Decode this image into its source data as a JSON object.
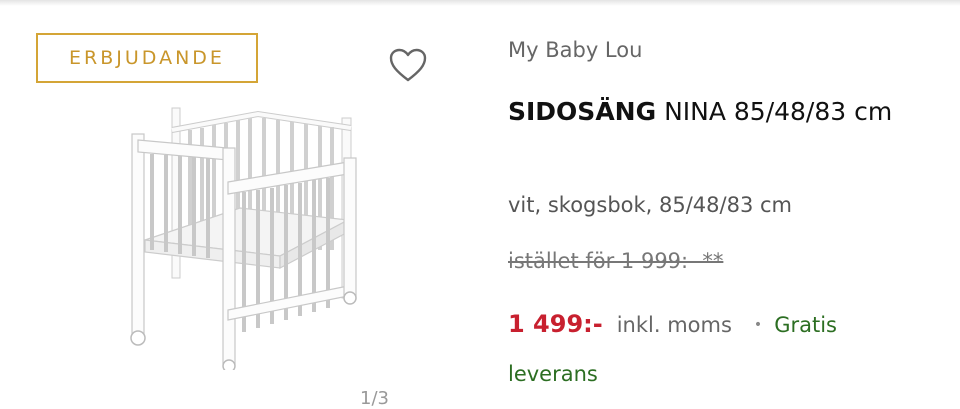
{
  "badge": "ERBJUDANDE",
  "icons": {
    "favorite": "heart-outline-icon"
  },
  "pager": "1/3",
  "product": {
    "brand": "My Baby Lou",
    "title_bold": "SIDOSÄNG",
    "title_rest": "NINA 85/48/83 cm",
    "variant": "vit, skogsbok, 85/48/83 cm",
    "old_price": "istället för 1 999:- **",
    "price": "1 499:-",
    "vat": "inkl. moms",
    "bullet": "•",
    "shipping_line1": "Gratis",
    "shipping_line2": "leverans"
  },
  "colors": {
    "badge": "#d4a536",
    "price": "#c8202f",
    "shipping": "#2c6e22"
  }
}
